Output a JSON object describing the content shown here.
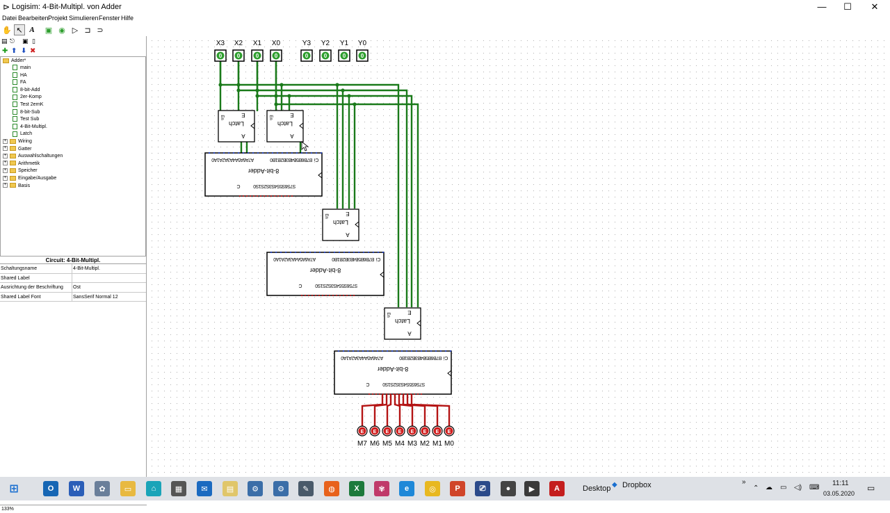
{
  "window": {
    "title": "Logisim: 4-Bit-Multipl. von Adder",
    "minimize": "—",
    "maximize": "☐",
    "close": "✕"
  },
  "menu": [
    "Datei",
    "Bearbeiten",
    "Projekt",
    "Simulieren",
    "Fenster",
    "Hilfe"
  ],
  "toolbar": {
    "poke_icon": "hand-poke-icon",
    "select_icon": "arrow-select-icon",
    "text_tool": "A"
  },
  "tree": {
    "root": "Adder*",
    "circuits": [
      "main",
      "HA",
      "FA",
      "8-bit-Add",
      "2er-Komp",
      "Test 2ernK",
      "8-bit-Sub",
      "Test Sub",
      "4-Bit-Multipl.",
      "Latch"
    ],
    "libraries": [
      "Wiring",
      "Gatter",
      "Auswahlschaltungen",
      "Arithmetik",
      "Speicher",
      "Eingabe/Ausgabe",
      "Basis"
    ]
  },
  "attributes": {
    "title": "Circuit: 4-Bit-Multipl.",
    "rows": [
      {
        "key": "Schaltungsname",
        "value": "4-Bit-Multipl."
      },
      {
        "key": "Shared Label",
        "value": ""
      },
      {
        "key": "Ausrichtung der Beschriftung",
        "value": "Ost"
      },
      {
        "key": "Shared Label Font",
        "value": "SansSerif Normal 12"
      }
    ]
  },
  "zoom": "133%",
  "circuit": {
    "inputs": [
      "X3",
      "X2",
      "X1",
      "X0",
      "Y3",
      "Y2",
      "Y1",
      "Y0"
    ],
    "input_value": "0",
    "outputs": [
      "M7",
      "M6",
      "M5",
      "M4",
      "M3",
      "M2",
      "M1",
      "M0"
    ],
    "output_value": "E",
    "latch_label": "Latch",
    "latch_pin_e": "E",
    "latch_pin_en": "En",
    "latch_pin_a": "A",
    "adder_label": "8-bit-Adder",
    "adder_pins_top": "A7A6A5A4A3A2A1A0",
    "adder_pins_top2": "B7B6B5B4B3B2B1B0",
    "adder_pins_bottom": "S7S6S5S4S3S2S1S0",
    "adder_pin_c": "C",
    "adder_pin_ci": "Ci",
    "wire_green": "#1a7a1a",
    "wire_red": "#b41414",
    "pin_green": "#2e9e2e",
    "pin_red": "#d02020"
  },
  "taskbar": {
    "desktop": "Desktop",
    "dropbox": "Dropbox",
    "time": "11:11",
    "date": "03.05.2020",
    "chevron": "»"
  }
}
